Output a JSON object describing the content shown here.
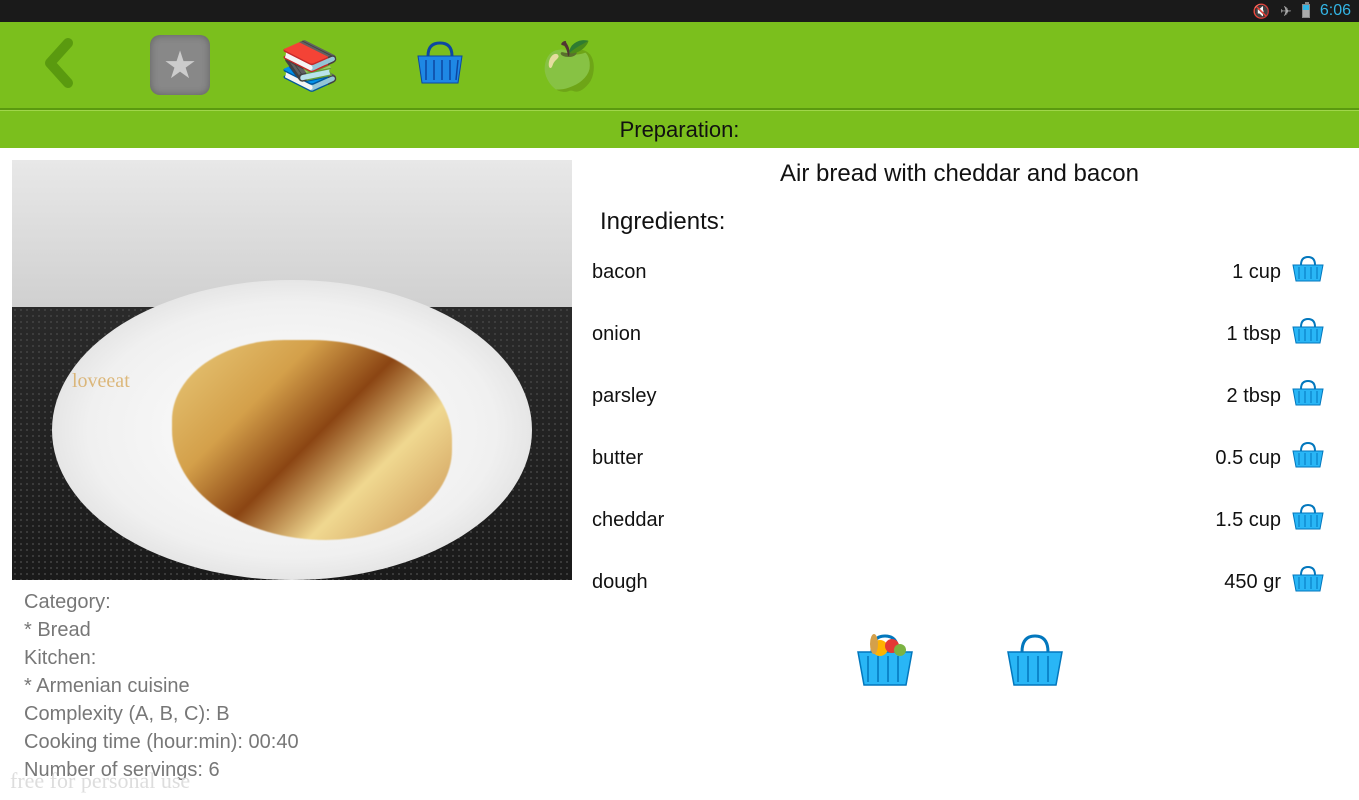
{
  "status_bar": {
    "time": "6:06"
  },
  "subheader": {
    "title": "Preparation:"
  },
  "recipe": {
    "title": "Air bread with cheddar and bacon",
    "ingredients_label": "Ingredients:",
    "ingredients": [
      {
        "name": "bacon",
        "quantity": "1 cup"
      },
      {
        "name": "onion",
        "quantity": "1 tbsp"
      },
      {
        "name": "parsley",
        "quantity": "2 tbsp"
      },
      {
        "name": "butter",
        "quantity": "0.5 cup"
      },
      {
        "name": "cheddar",
        "quantity": "1.5 cup"
      },
      {
        "name": "dough",
        "quantity": "450 gr"
      }
    ],
    "photo_watermark": "loveeat"
  },
  "meta": {
    "category_label": "Category:",
    "category_value": "* Bread",
    "kitchen_label": "Kitchen:",
    "kitchen_value": "* Armenian cuisine",
    "complexity": "Complexity (A, B, C): B",
    "cooking_time": "Cooking time (hour:min): 00:40",
    "servings": "Number of servings: 6"
  },
  "footer": {
    "text": "free for personal use"
  }
}
